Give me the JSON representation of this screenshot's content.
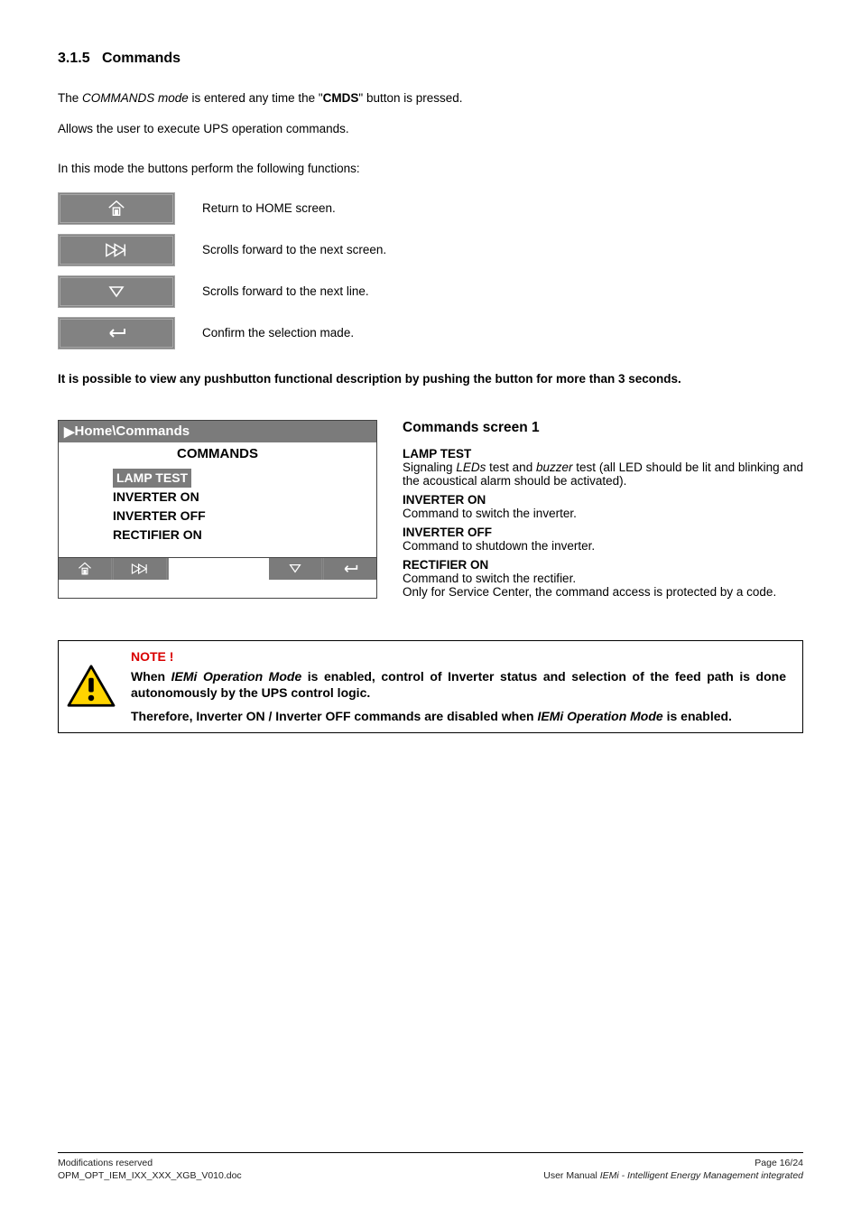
{
  "section": {
    "number": "3.1.5",
    "title": "Commands"
  },
  "intro": {
    "line1_pre": "The ",
    "line1_em": "COMMANDS mode",
    "line1_mid": " is entered any time the \"",
    "line1_bold": "CMDS",
    "line1_post": "\" button is pressed.",
    "line2": "Allows the user to execute UPS operation commands.",
    "line3": "In this mode the buttons perform the following functions:"
  },
  "buttons": {
    "home": "Return to HOME screen.",
    "nextscreen": "Scrolls forward to the next screen.",
    "nextline": "Scrolls forward to the next line.",
    "confirm": "Confirm the selection made."
  },
  "hint": "It is possible to view any pushbutton functional description by pushing the button for more than 3 seconds.",
  "lcd": {
    "breadcrumb": "Home\\Commands",
    "title": "COMMANDS",
    "items": [
      "LAMP TEST",
      "INVERTER ON",
      "INVERTER OFF",
      "RECTIFIER ON"
    ]
  },
  "desc": {
    "heading": "Commands screen 1",
    "lamp_h": "LAMP TEST",
    "lamp_p_pre": "Signaling ",
    "lamp_p_em1": "LEDs",
    "lamp_p_mid": " test and ",
    "lamp_p_em2": "buzzer",
    "lamp_p_post": " test (all LED should be lit and blinking and the acoustical alarm should be activated).",
    "invon_h": "INVERTER ON",
    "invon_p": "Command to switch the inverter.",
    "invoff_h": "INVERTER OFF",
    "invoff_p": "Command to shutdown the inverter.",
    "rect_h": "RECTIFIER ON",
    "rect_p1": "Command to switch the rectifier.",
    "rect_p2": "Only for Service Center, the command access is protected by a code."
  },
  "note": {
    "title": "NOTE !",
    "p1_pre": "When ",
    "p1_em": "IEMi Operation Mode",
    "p1_post": " is enabled, control of Inverter status and selection of the feed path is done autonomously by the UPS control logic.",
    "p2_pre": "Therefore, Inverter ON / Inverter OFF commands are disabled when ",
    "p2_em": "IEMi Operation Mode",
    "p2_post": " is enabled."
  },
  "footer": {
    "left1": "Modifications reserved",
    "left2": "OPM_OPT_IEM_IXX_XXX_XGB_V010.doc",
    "right1": "Page 16/24",
    "right2_pre": "User Manual ",
    "right2_em": "IEMi - Intelligent Energy Management integrated"
  }
}
